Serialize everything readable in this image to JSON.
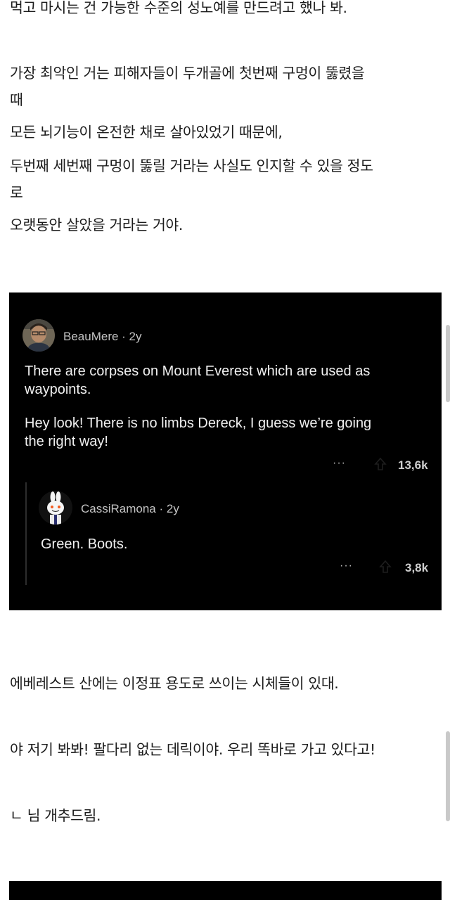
{
  "article": {
    "top_partial": "먹고 마시는 건 가능한 수준의 성노예를 만드려고 했나 봐.",
    "para1_l1": "가장 최악인 거는 피해자들이 두개골에 첫번째 구멍이 뚫렸을",
    "para1_l2": "때",
    "para1_l3": "모든 뇌기능이 온전한 채로 살아있었기 때문에,",
    "para1_l4": "두번째 세번째 구멍이 뚫릴 거라는 사실도 인지할 수 있을 정도",
    "para1_l5": "로",
    "para1_l6": "오랫동안 살았을 거라는 거야.",
    "trans1": "에베레스트 산에는 이정표 용도로 쓰이는 시체들이 있대.",
    "trans2": "야 저기 봐봐! 팔다리 없는 데릭이야. 우리 똑바로 가고 있다고!",
    "trans3": "ㄴ 님 개추드림."
  },
  "comments": {
    "c1": {
      "username": "BeauMere",
      "age": " · 2y",
      "line1": "There are corpses on Mount Everest which are used as",
      "line2": "waypoints.",
      "line3": "Hey look! There is no limbs Dereck, I guess we’re going",
      "line4": "the right way!",
      "more": "···",
      "votes": "13,6k"
    },
    "c2": {
      "username": "CassiRamona",
      "age": " · 2y",
      "line1": "Green. Boots.",
      "more": "···",
      "votes": "3,8k"
    }
  },
  "icons": {
    "avatar1": "user-photo-avatar",
    "avatar2": "bunny-avatar",
    "more": "more-options-icon",
    "upvote": "upvote-arrow-icon"
  },
  "colors": {
    "panel_bg": "#000000",
    "username": "#c4c4c4",
    "comment_text": "#f0f0f0"
  }
}
